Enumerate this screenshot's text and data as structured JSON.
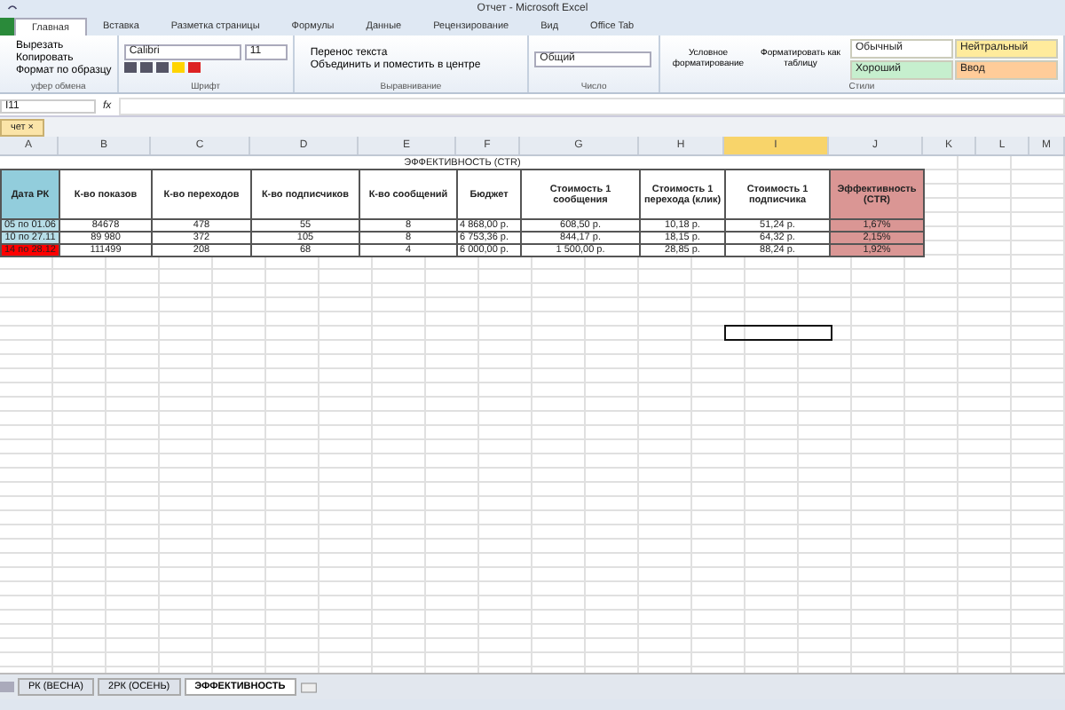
{
  "window": {
    "title": "Отчет  -  Microsoft Excel"
  },
  "ribbon_tabs": [
    {
      "label": "Главная",
      "selected": true
    },
    {
      "label": "Вставка",
      "selected": false
    },
    {
      "label": "Разметка страницы",
      "selected": false
    },
    {
      "label": "Формулы",
      "selected": false
    },
    {
      "label": "Данные",
      "selected": false
    },
    {
      "label": "Рецензирование",
      "selected": false
    },
    {
      "label": "Вид",
      "selected": false
    },
    {
      "label": "Office Tab",
      "selected": false
    }
  ],
  "clipboard": {
    "buttons": [
      "Вырезать",
      "Копировать",
      "Формат по образцу"
    ],
    "group_label": "уфер обмена"
  },
  "font": {
    "name": "Calibri",
    "size": "11",
    "group_label": "Шрифт"
  },
  "alignment": {
    "buttons": [
      "Перенос текста",
      "Объединить и поместить в центре"
    ],
    "group_label": "Выравнивание"
  },
  "number": {
    "format": "Общий",
    "group_label": "Число"
  },
  "styles": {
    "buttons": [
      "Условное форматирование",
      "Форматировать как таблицу"
    ],
    "cell_styles": [
      {
        "label": "Обычный",
        "color": "#ffffff"
      },
      {
        "label": "Нейтральный",
        "color": "#ffeb9c"
      },
      {
        "label": "Хороший",
        "color": "#c6efce"
      },
      {
        "label": "Ввод",
        "color": "#ffcc99"
      }
    ],
    "group_label": "Стили"
  },
  "formula_bar": {
    "name_box": "I11",
    "fx": "fx"
  },
  "doc_tab": {
    "label": "чет",
    "close": "×"
  },
  "columns": [
    {
      "label": "A",
      "selected": false
    },
    {
      "label": "B",
      "selected": false
    },
    {
      "label": "C",
      "selected": false
    },
    {
      "label": "D",
      "selected": false
    },
    {
      "label": "E",
      "selected": false
    },
    {
      "label": "F",
      "selected": false
    },
    {
      "label": "G",
      "selected": false
    },
    {
      "label": "H",
      "selected": false
    },
    {
      "label": "I",
      "selected": true
    },
    {
      "label": "J",
      "selected": false
    },
    {
      "label": "K",
      "selected": false
    },
    {
      "label": "L",
      "selected": false
    },
    {
      "label": "M",
      "selected": false
    }
  ],
  "table": {
    "title": "ЭФФЕКТИВНОСТЬ (CTR)",
    "headers": [
      {
        "text": "Дата РК",
        "color": "#92cddc"
      },
      {
        "text": "К-во показов"
      },
      {
        "text": "К-во переходов"
      },
      {
        "text": "К-во подписчиков"
      },
      {
        "text": "К-во сообщений"
      },
      {
        "text": "Бюджет"
      },
      {
        "text": "Стоимость 1 сообщения"
      },
      {
        "text": "Стоимость 1 перехода (клик)"
      },
      {
        "text": "Стоимость 1 подписчика"
      },
      {
        "text": "Эффективность (CTR)",
        "color": "#da9694"
      }
    ],
    "rows": [
      {
        "cells": [
          {
            "text": "05 по 01.06",
            "color": "#b7dee8"
          },
          {
            "text": "84678"
          },
          {
            "text": "478"
          },
          {
            "text": "55"
          },
          {
            "text": "8"
          },
          {
            "text": "4 868,00 р."
          },
          {
            "text": "608,50 р."
          },
          {
            "text": "10,18 р."
          },
          {
            "text": "51,24 р."
          },
          {
            "text": "1,67%",
            "color": "#da9694"
          }
        ]
      },
      {
        "cells": [
          {
            "text": "10 по 27.11",
            "color": "#b7dee8"
          },
          {
            "text": "89 980"
          },
          {
            "text": "372"
          },
          {
            "text": "105"
          },
          {
            "text": "8"
          },
          {
            "text": "6 753,36 р."
          },
          {
            "text": "844,17 р."
          },
          {
            "text": "18,15 р."
          },
          {
            "text": "64,32 р."
          },
          {
            "text": "2,15%",
            "color": "#da9694"
          }
        ]
      },
      {
        "cells": [
          {
            "text": "14 по 28.12",
            "color": "#ff0000"
          },
          {
            "text": "111499"
          },
          {
            "text": "208"
          },
          {
            "text": "68"
          },
          {
            "text": "4"
          },
          {
            "text": "6 000,00 р."
          },
          {
            "text": "1 500,00 р."
          },
          {
            "text": "28,85 р."
          },
          {
            "text": "88,24 р."
          },
          {
            "text": "1,92%",
            "color": "#da9694"
          }
        ]
      }
    ]
  },
  "sheet_tabs": [
    {
      "label": "РК (ВЕСНА)",
      "selected": false
    },
    {
      "label": "2РК (ОСЕНЬ)",
      "selected": false
    },
    {
      "label": "ЭФФЕКТИВНОСТЬ",
      "selected": true
    }
  ]
}
